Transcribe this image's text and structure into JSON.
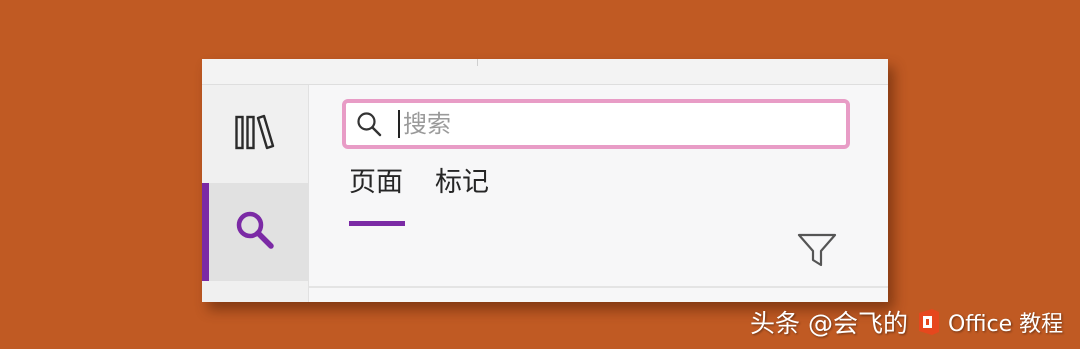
{
  "search": {
    "placeholder": "搜索"
  },
  "tabs": [
    {
      "label": "页面",
      "active": true
    },
    {
      "label": "标记",
      "active": false
    }
  ],
  "rail": {
    "items": [
      {
        "icon": "notebooks-icon"
      },
      {
        "icon": "search-icon",
        "active": true
      }
    ]
  },
  "watermark": {
    "text": "头条 @会飞的",
    "tail": "Office 教程"
  },
  "colors": {
    "background": "#c05a23",
    "accent": "#7b2aa5",
    "search_focus_border": "#e89cc6"
  }
}
